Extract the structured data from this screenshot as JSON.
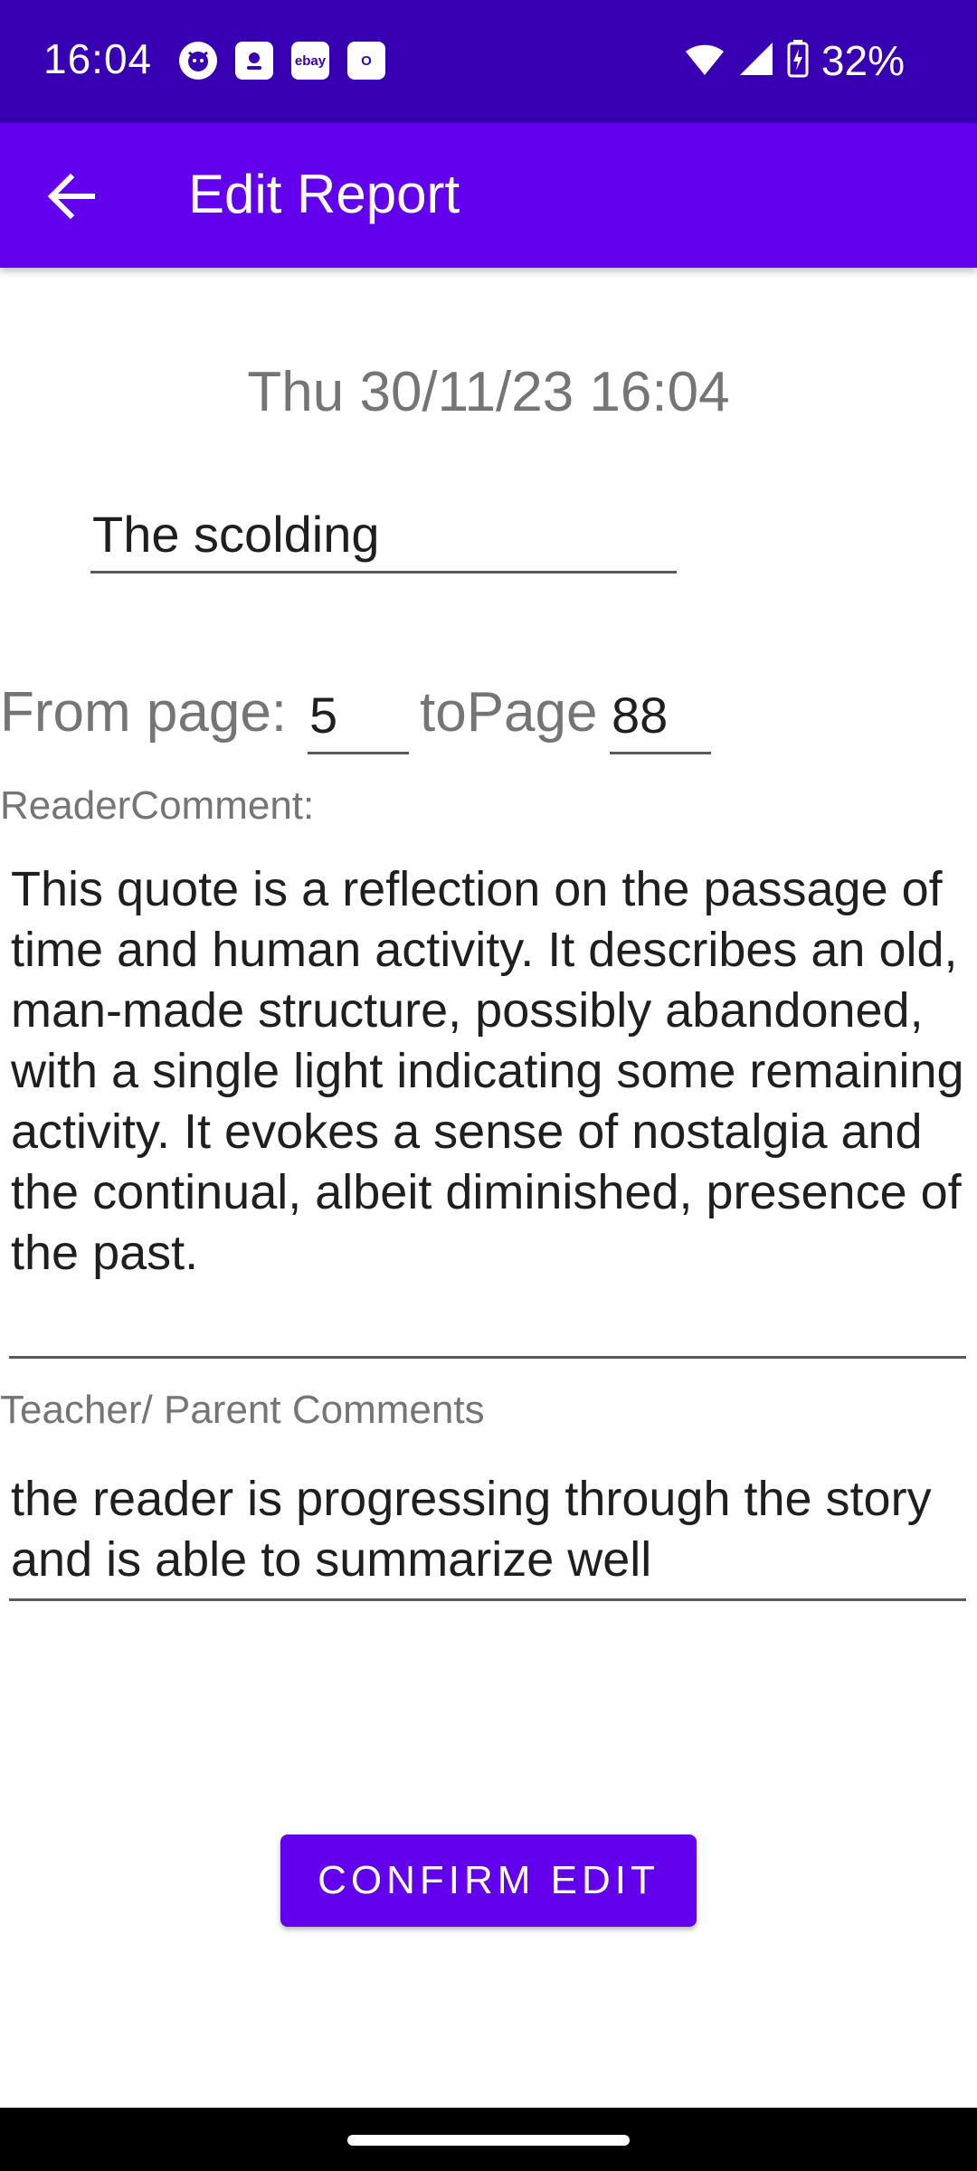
{
  "status_bar": {
    "time": "16:04",
    "notification_icons": [
      "cat-face-icon",
      "person-badge-icon",
      "ebay-icon",
      "outlook-icon"
    ],
    "ebay_label": "ebay",
    "outlook_label": "O",
    "battery": "32%"
  },
  "app_bar": {
    "title": "Edit Report",
    "back_icon": "arrow-back-icon"
  },
  "report": {
    "date": "Thu 30/11/23 16:04",
    "title_value": "The scolding",
    "from_page_label": "From page:",
    "from_page_value": "5",
    "to_page_label": "toPage",
    "to_page_value": "88",
    "reader_comment_label": "ReaderComment:",
    "reader_comment_value": "This quote is a reflection on the passage of time and human activity. It describes an old, man-made structure, possibly abandoned, with a single light indicating some remaining activity. It evokes a sense of nostalgia and the continual, albeit diminished, presence of the past.",
    "teacher_comment_label": "Teacher/ Parent Comments",
    "teacher_comment_value": " the reader is progressing through the story and is able to summarize well"
  },
  "actions": {
    "confirm_label": "CONFIRM EDIT"
  },
  "colors": {
    "status_bar": "#3700b3",
    "app_bar": "#6200ee",
    "button": "#6200ee"
  }
}
